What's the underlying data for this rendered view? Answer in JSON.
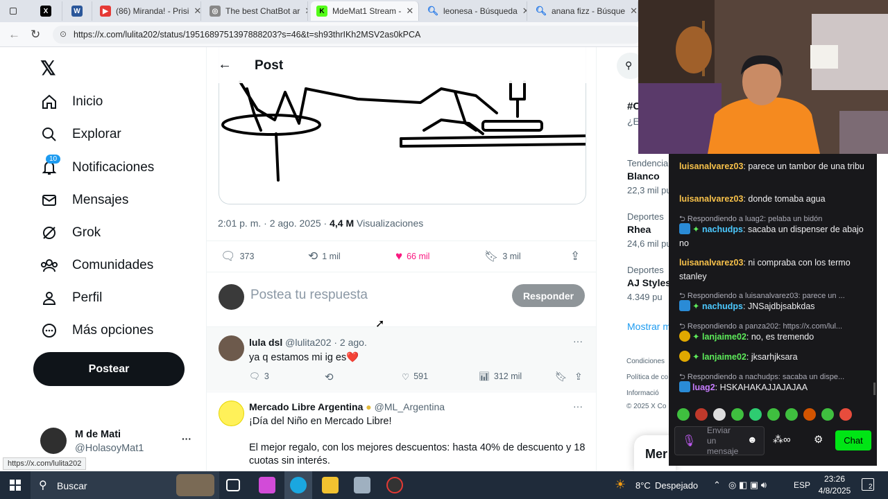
{
  "browser": {
    "tabs": [
      {
        "label": "(86) Miranda! - Prisi",
        "icon": "youtube-icon",
        "color": "#e53935"
      },
      {
        "label": "The best ChatBot ar",
        "icon": "chatbot-icon",
        "color": "#777777"
      },
      {
        "label": "MdeMat1 Stream -",
        "icon": "kick-icon",
        "color": "#53fc18"
      },
      {
        "label": "leonesa - Búsqueda",
        "icon": "search-icon",
        "color": "#1a73e8"
      },
      {
        "label": "anana fizz - Búsque",
        "icon": "search-icon",
        "color": "#1a73e8"
      }
    ],
    "url": "https://x.com/lulita202/status/1951689751397888203?s=46&t=sh93thrIKh2MSV2as0kPCA",
    "status_url": "https://x.com/lulita202"
  },
  "nav": {
    "items": [
      {
        "label": "Inicio",
        "icon": "home-icon"
      },
      {
        "label": "Explorar",
        "icon": "search-icon"
      },
      {
        "label": "Notificaciones",
        "icon": "bell-icon",
        "badge": "10"
      },
      {
        "label": "Mensajes",
        "icon": "mail-icon"
      },
      {
        "label": "Grok",
        "icon": "grok-icon"
      },
      {
        "label": "Comunidades",
        "icon": "communities-icon"
      },
      {
        "label": "Perfil",
        "icon": "person-icon"
      },
      {
        "label": "Más opciones",
        "icon": "more-circle-icon"
      }
    ],
    "post_button": "Postear",
    "account": {
      "name": "M de Mati",
      "handle": "@HolasoyMat1",
      "more": "···"
    }
  },
  "post": {
    "header": "Post",
    "meta_time": "2:01 p. m. · 2 ago. 2025 · ",
    "views_count": "4,4 M",
    "views_label": "Visualizaciones",
    "actions": {
      "replies": "373",
      "reposts": "1 mil",
      "likes": "66 mil",
      "bookmarks": "3 mil"
    },
    "reply_placeholder": "Postea tu respuesta",
    "reply_button": "Responder"
  },
  "replies": [
    {
      "name": "lula dsl",
      "handle": "@lulita202 · 2 ago.",
      "text": "ya q estamos mi ig es❤️",
      "replies": "3",
      "likes": "591",
      "views": "312 mil"
    },
    {
      "name": "Mercado Libre Argentina",
      "handle": "@ML_Argentina",
      "line1": "¡Día del Niño en Mercado Libre!",
      "line2": "El mejor regalo, con los mejores descuentos: hasta 40% de descuento y 18",
      "line3": "cuotas sin interés."
    }
  ],
  "sidebar": {
    "hashtag": "#C",
    "hashtag_sub": "¿E",
    "trends": [
      {
        "cat": "Tendencia",
        "name": "Blanco",
        "count": "22,3 mil pu"
      },
      {
        "cat": "Deportes",
        "name": "Rhea",
        "count": "24,6 mil pu"
      },
      {
        "cat": "Deportes",
        "name": "AJ Styles",
        "count": "4.349 pu"
      }
    ],
    "show_more": "Mostrar m",
    "footer": [
      "Condiciones",
      "Política de co",
      "Informació",
      "© 2025 X Co"
    ],
    "messages_tab": "Mer"
  },
  "chat": {
    "messages": [
      {
        "type": "msg",
        "user": "luisanalvarez03",
        "text": "parece un tambor de una tribu"
      },
      {
        "type": "msg",
        "user": "luisanalvarez03",
        "text": "donde tomaba agua"
      },
      {
        "type": "reply",
        "text": "Respondiendo a luag2: pelaba un bidón"
      },
      {
        "type": "msg",
        "user": "nachudps",
        "text": "sacaba un dispenser de abajo no"
      },
      {
        "type": "msg",
        "user": "luisanalvarez03",
        "text": "ni compraba con los termo stanley"
      },
      {
        "type": "reply",
        "text": "Respondiendo a luisanalvarez03: parece un ..."
      },
      {
        "type": "msg",
        "user": "nachudps",
        "text": "JNSajdbjsabkdas"
      },
      {
        "type": "reply",
        "text": "Respondiendo a panza202: https://x.com/lul..."
      },
      {
        "type": "msg",
        "user": "lanjaime02",
        "text": "no, es tremendo"
      },
      {
        "type": "msg",
        "user": "lanjaime02",
        "text": "jksarhjksara"
      },
      {
        "type": "reply",
        "text": "Respondiendo a nachudps: sacaba un dispe..."
      },
      {
        "type": "msg",
        "user": "luag2",
        "text": "HSKAHAKAJJAJAJAA"
      }
    ],
    "input_placeholder": "Enviar un mensaje",
    "send_button": "Chat"
  },
  "taskbar": {
    "search_placeholder": "Buscar",
    "weather_temp": "8°C",
    "weather_text": "Despejado",
    "language": "ESP",
    "time": "23:26",
    "date": "4/8/2025",
    "notifications": "2"
  },
  "colors": {
    "like": "#f91880",
    "x_black": "#0f1419",
    "chat_send": "#00c853",
    "badge_blue": "#1d9bf0"
  }
}
